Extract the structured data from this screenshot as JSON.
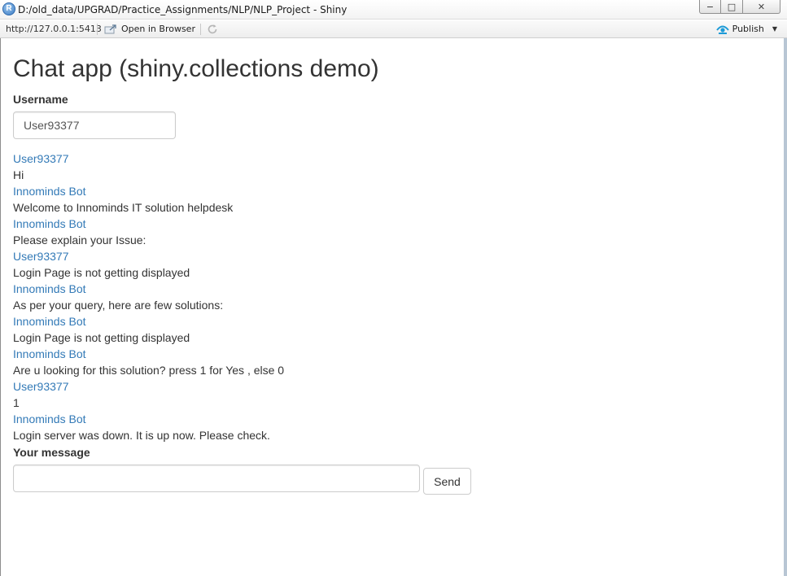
{
  "window": {
    "title": "D:/old_data/UPGRAD/Practice_Assignments/NLP/NLP_Project - Shiny",
    "icon_letter": "R",
    "buttons": {
      "minimize": "−",
      "maximize": "□",
      "close": "✕"
    }
  },
  "toolbar": {
    "url": "http://127.0.0.1:5413",
    "open_in_browser": "Open in Browser",
    "publish": "Publish",
    "publish_caret": "▼"
  },
  "page": {
    "title": "Chat app (shiny.collections demo)",
    "username_label": "Username",
    "username_value": "User93377",
    "message_label": "Your message",
    "message_value": "",
    "send_label": "Send"
  },
  "messages": [
    {
      "user": "User93377",
      "text": "Hi"
    },
    {
      "user": "Innominds Bot",
      "text": "Welcome to Innominds IT solution helpdesk"
    },
    {
      "user": "Innominds Bot",
      "text": "Please explain your Issue:"
    },
    {
      "user": "User93377",
      "text": "Login Page is not getting displayed"
    },
    {
      "user": "Innominds Bot",
      "text": "As per your query, here are few solutions:"
    },
    {
      "user": "Innominds Bot",
      "text": "Login Page is not getting displayed"
    },
    {
      "user": "Innominds Bot",
      "text": "Are u looking for this solution? press 1 for Yes , else 0"
    },
    {
      "user": "User93377",
      "text": "1"
    },
    {
      "user": "Innominds Bot",
      "text": "Login server was down. It is up now. Please check."
    }
  ],
  "colors": {
    "username_link": "#337ab7",
    "text": "#333333",
    "publish_icon": "#1e9bd7"
  }
}
